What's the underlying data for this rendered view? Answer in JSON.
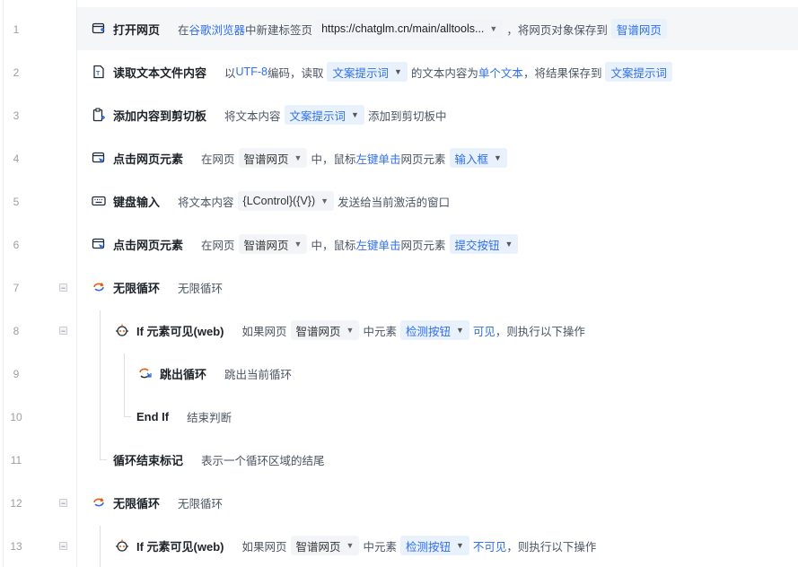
{
  "line_numbers": [
    "1",
    "2",
    "3",
    "4",
    "5",
    "6",
    "7",
    "8",
    "9",
    "10",
    "11",
    "12",
    "13"
  ],
  "rows": {
    "r1": {
      "title": "打开网页",
      "p1": "在",
      "p2": "谷歌浏览器",
      "p3": "中新建标签页",
      "url": "https://chatglm.cn/main/alltools...",
      "p4": "，将网页对象保存到",
      "var": "智谱网页"
    },
    "r2": {
      "title": "读取文本文件内容",
      "p1": "以",
      "p2": "UTF-8",
      "p3": "编码，读取",
      "chip": "文案提示词",
      "p4": "的文本内容为",
      "p5": "单个文本",
      "p6": "，将结果保存到",
      "var": "文案提示词"
    },
    "r3": {
      "title": "添加内容到剪切板",
      "p1": "将文本内容",
      "chip": "文案提示词",
      "p2": "添加到剪切板中"
    },
    "r4": {
      "title": "点击网页元素",
      "p1": "在网页",
      "page": "智谱网页",
      "p2": "中，鼠标",
      "p3": "左键单击",
      "p4": "网页元素",
      "elem": "输入框"
    },
    "r5": {
      "title": "键盘输入",
      "p1": "将文本内容",
      "chip": "{LControl}({V})",
      "p2": "发送给当前激活的窗口"
    },
    "r6": {
      "title": "点击网页元素",
      "p1": "在网页",
      "page": "智谱网页",
      "p2": "中，鼠标",
      "p3": "左键单击",
      "p4": "网页元素",
      "elem": "提交按钮"
    },
    "r7": {
      "title": "无限循环",
      "desc": "无限循环"
    },
    "r8": {
      "title": "If 元素可见(web)",
      "p1": "如果网页",
      "page": "智谱网页",
      "p2": "中元素",
      "elem": "检测按钮",
      "p3": "可见",
      "p4": "，则执行以下操作"
    },
    "r9": {
      "title": "跳出循环",
      "desc": "跳出当前循环"
    },
    "r10": {
      "title": "End If",
      "desc": "结束判断"
    },
    "r11": {
      "title": "循环结束标记",
      "desc": "表示一个循环区域的结尾"
    },
    "r12": {
      "title": "无限循环",
      "desc": "无限循环"
    },
    "r13": {
      "title": "If 元素可见(web)",
      "p1": "如果网页",
      "page": "智谱网页",
      "p2": "中元素",
      "elem": "检测按钮",
      "p3": "不可见",
      "p4": "，则执行以下操作"
    }
  },
  "collapse_symbol": "−",
  "chevron": "⌄",
  "colors": {
    "accent": "#2f6feb",
    "chip_blue_bg": "#e9f1fd",
    "chip_gray_bg": "#f2f4f7",
    "selected_row_bg": "#f5f6f8"
  }
}
